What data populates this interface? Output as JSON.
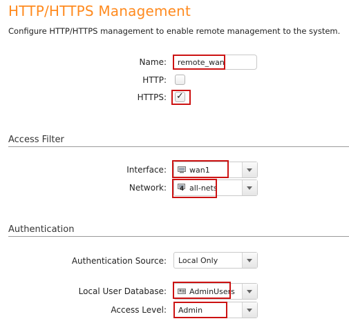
{
  "page": {
    "title": "HTTP/HTTPS Management",
    "description": "Configure HTTP/HTTPS management to enable remote management to the system."
  },
  "general": {
    "name_label": "Name:",
    "name_value": "remote_wan",
    "http_label": "HTTP:",
    "http_checked": false,
    "https_label": "HTTPS:",
    "https_checked": true
  },
  "access_filter": {
    "heading": "Access Filter",
    "interface_label": "Interface:",
    "interface_value": "wan1",
    "interface_icon": "interface-icon",
    "network_label": "Network:",
    "network_value": "all-nets",
    "network_icon_badge": "4",
    "network_icon": "network-object-icon"
  },
  "authentication": {
    "heading": "Authentication",
    "source_label": "Authentication Source:",
    "source_value": "Local Only",
    "user_db_label": "Local User Database:",
    "user_db_value": "AdminUsers",
    "user_db_icon": "user-database-icon",
    "access_level_label": "Access Level:",
    "access_level_value": "Admin"
  },
  "colors": {
    "title": "#ff8a1e",
    "highlight": "#cc1111"
  }
}
